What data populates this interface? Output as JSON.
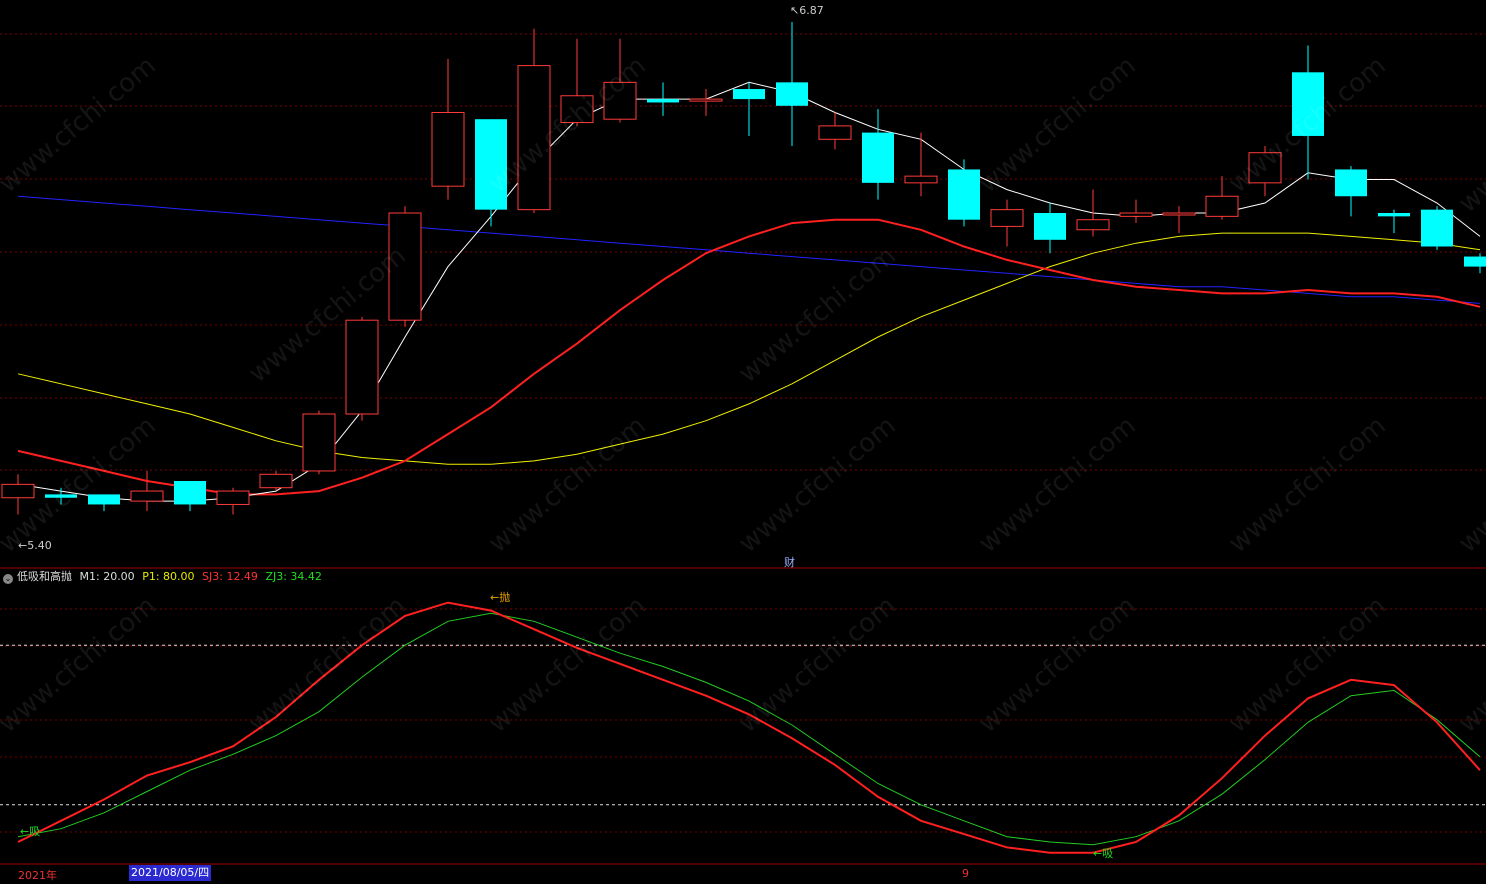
{
  "indicator": {
    "name": "低吸和高抛",
    "params": [
      {
        "label": "M1: 20.00",
        "color": "#dddddd"
      },
      {
        "label": "P1: 80.00",
        "color": "#e8e800"
      },
      {
        "label": "SJ3: 12.49",
        "color": "#ff3333"
      },
      {
        "label": "ZJ3: 34.42",
        "color": "#22dd22"
      }
    ]
  },
  "labels": {
    "high_marker": "6.87",
    "low_marker": "5.40",
    "buy_label_1": "吸",
    "sell_label": "抛",
    "buy_label_2": "吸",
    "finance_marker": "财",
    "year": "2021年",
    "date_cursor": "2021/08/05/四",
    "month_tick": "9"
  },
  "watermark": "www.cfchi.com",
  "colors": {
    "up": "#ff3a3a",
    "down": "#00ffff",
    "ma5": "#ffffff",
    "ma10": "#ff2020",
    "ma20": "#f0f000",
    "ma60": "#2222ff",
    "sj3": "#ff2020",
    "zj3": "#22cc22",
    "grid": "#7a0000"
  },
  "chart_data": [
    {
      "type": "candlestick",
      "ylim": [
        5.3,
        6.9
      ],
      "candles": [
        {
          "o": 5.45,
          "c": 5.49,
          "h": 5.52,
          "l": 5.4
        },
        {
          "o": 5.46,
          "c": 5.45,
          "h": 5.48,
          "l": 5.43
        },
        {
          "o": 5.46,
          "c": 5.43,
          "h": 5.46,
          "l": 5.41
        },
        {
          "o": 5.44,
          "c": 5.47,
          "h": 5.53,
          "l": 5.41
        },
        {
          "o": 5.5,
          "c": 5.43,
          "h": 5.5,
          "l": 5.41
        },
        {
          "o": 5.43,
          "c": 5.47,
          "h": 5.48,
          "l": 5.4
        },
        {
          "o": 5.48,
          "c": 5.52,
          "h": 5.53,
          "l": 5.47
        },
        {
          "o": 5.53,
          "c": 5.7,
          "h": 5.71,
          "l": 5.52
        },
        {
          "o": 5.7,
          "c": 5.98,
          "h": 5.99,
          "l": 5.68
        },
        {
          "o": 5.98,
          "c": 6.3,
          "h": 6.32,
          "l": 5.96
        },
        {
          "o": 6.38,
          "c": 6.6,
          "h": 6.76,
          "l": 6.34
        },
        {
          "o": 6.58,
          "c": 6.31,
          "h": 6.58,
          "l": 6.26
        },
        {
          "o": 6.31,
          "c": 6.74,
          "h": 6.85,
          "l": 6.3
        },
        {
          "o": 6.57,
          "c": 6.65,
          "h": 6.82,
          "l": 6.56
        },
        {
          "o": 6.58,
          "c": 6.69,
          "h": 6.82,
          "l": 6.57
        },
        {
          "o": 6.64,
          "c": 6.63,
          "h": 6.69,
          "l": 6.59
        },
        {
          "o": 6.64,
          "c": 6.64,
          "h": 6.67,
          "l": 6.59
        },
        {
          "o": 6.67,
          "c": 6.64,
          "h": 6.69,
          "l": 6.53
        },
        {
          "o": 6.69,
          "c": 6.62,
          "h": 6.87,
          "l": 6.5
        },
        {
          "o": 6.52,
          "c": 6.56,
          "h": 6.6,
          "l": 6.49
        },
        {
          "o": 6.54,
          "c": 6.39,
          "h": 6.61,
          "l": 6.34
        },
        {
          "o": 6.39,
          "c": 6.41,
          "h": 6.54,
          "l": 6.35
        },
        {
          "o": 6.43,
          "c": 6.28,
          "h": 6.46,
          "l": 6.26
        },
        {
          "o": 6.26,
          "c": 6.31,
          "h": 6.34,
          "l": 6.2
        },
        {
          "o": 6.3,
          "c": 6.22,
          "h": 6.33,
          "l": 6.18
        },
        {
          "o": 6.25,
          "c": 6.28,
          "h": 6.37,
          "l": 6.23
        },
        {
          "o": 6.29,
          "c": 6.3,
          "h": 6.34,
          "l": 6.27
        },
        {
          "o": 6.3,
          "c": 6.3,
          "h": 6.32,
          "l": 6.24
        },
        {
          "o": 6.29,
          "c": 6.35,
          "h": 6.41,
          "l": 6.28
        },
        {
          "o": 6.39,
          "c": 6.48,
          "h": 6.5,
          "l": 6.35
        },
        {
          "o": 6.72,
          "c": 6.53,
          "h": 6.8,
          "l": 6.4
        },
        {
          "o": 6.43,
          "c": 6.35,
          "h": 6.44,
          "l": 6.29
        },
        {
          "o": 6.3,
          "c": 6.29,
          "h": 6.31,
          "l": 6.24
        },
        {
          "o": 6.31,
          "c": 6.2,
          "h": 6.32,
          "l": 6.19
        },
        {
          "o": 6.17,
          "c": 6.14,
          "h": 6.18,
          "l": 6.12
        }
      ],
      "ma5": [
        5.49,
        5.47,
        5.45,
        5.44,
        5.44,
        5.45,
        5.47,
        5.55,
        5.71,
        5.93,
        6.14,
        6.29,
        6.45,
        6.58,
        6.64,
        6.64,
        6.64,
        6.69,
        6.66,
        6.6,
        6.55,
        6.52,
        6.43,
        6.37,
        6.33,
        6.3,
        6.29,
        6.3,
        6.3,
        6.33,
        6.42,
        6.4,
        6.4,
        6.33,
        6.23
      ],
      "ma10": [
        5.59,
        5.56,
        5.53,
        5.5,
        5.48,
        5.46,
        5.46,
        5.47,
        5.51,
        5.56,
        5.64,
        5.72,
        5.82,
        5.91,
        6.01,
        6.1,
        6.18,
        6.23,
        6.27,
        6.28,
        6.28,
        6.25,
        6.2,
        6.16,
        6.13,
        6.1,
        6.08,
        6.07,
        6.06,
        6.06,
        6.07,
        6.06,
        6.06,
        6.05,
        6.02
      ],
      "ma20": [
        5.82,
        5.79,
        5.76,
        5.73,
        5.7,
        5.66,
        5.62,
        5.59,
        5.57,
        5.56,
        5.55,
        5.55,
        5.56,
        5.58,
        5.61,
        5.64,
        5.68,
        5.73,
        5.79,
        5.86,
        5.93,
        5.99,
        6.04,
        6.09,
        6.14,
        6.18,
        6.21,
        6.23,
        6.24,
        6.24,
        6.24,
        6.23,
        6.22,
        6.21,
        6.19
      ],
      "ma60": [
        6.35,
        6.34,
        6.33,
        6.32,
        6.31,
        6.3,
        6.29,
        6.28,
        6.27,
        6.26,
        6.25,
        6.24,
        6.23,
        6.22,
        6.21,
        6.2,
        6.19,
        6.18,
        6.17,
        6.16,
        6.15,
        6.14,
        6.13,
        6.12,
        6.11,
        6.1,
        6.09,
        6.08,
        6.08,
        6.07,
        6.06,
        6.05,
        6.05,
        6.04,
        6.03
      ]
    },
    {
      "type": "line",
      "name": "低吸和高抛",
      "ylim": [
        0,
        100
      ],
      "ref_levels": [
        20,
        80
      ],
      "series": [
        {
          "name": "SJ3",
          "values": [
            6,
            14,
            22,
            31,
            36,
            42,
            53,
            67,
            80,
            91,
            96,
            93,
            86,
            79,
            73,
            67,
            61,
            54,
            45,
            35,
            23,
            14,
            9,
            4,
            2,
            2,
            6,
            16,
            30,
            46,
            60,
            67,
            65,
            51,
            33
          ]
        },
        {
          "name": "ZJ3",
          "values": [
            8,
            11,
            17,
            25,
            33,
            39,
            46,
            55,
            68,
            80,
            89,
            92,
            89,
            83,
            77,
            72,
            66,
            59,
            50,
            39,
            28,
            20,
            14,
            8,
            6,
            5,
            8,
            14,
            24,
            37,
            51,
            61,
            63,
            52,
            38
          ]
        }
      ]
    }
  ]
}
